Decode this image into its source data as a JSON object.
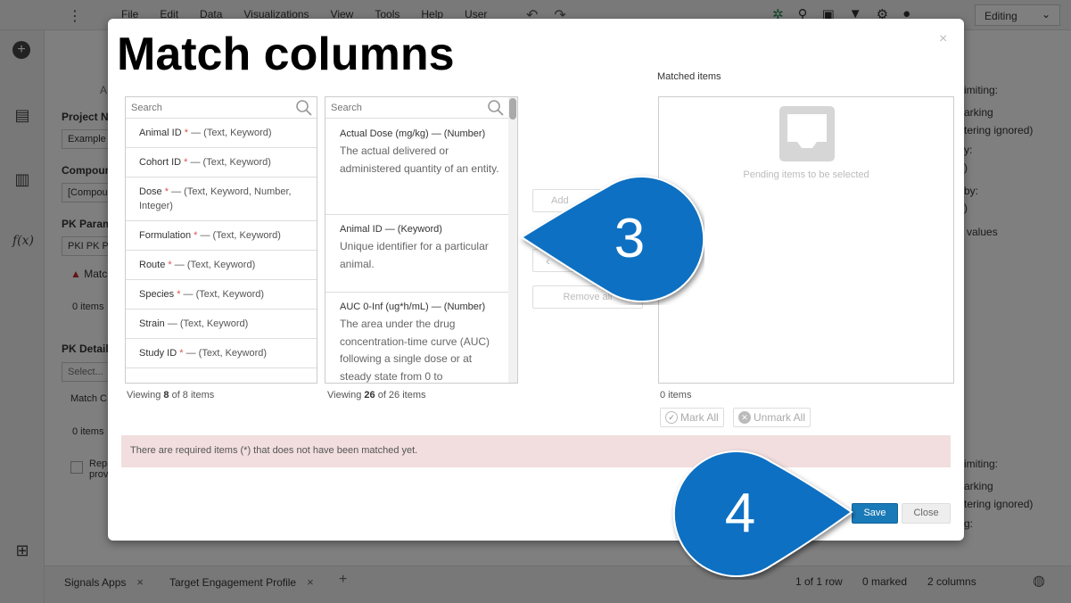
{
  "app": {
    "menu": [
      "File",
      "Edit",
      "Data",
      "Visualizations",
      "View",
      "Tools",
      "Help",
      "User"
    ],
    "mode_select": "Editing",
    "background": {
      "project_label": "Project N",
      "project_value": "Example",
      "compound_label": "Compoun",
      "compound_value": "[Compou",
      "pk_param_label": "PK Param",
      "pk_param_value": "PKI PK P",
      "match_warning": "Match",
      "zero_items_1": "0 items",
      "pk_detail_label": "PK Detail",
      "select_placeholder": "Select...",
      "match_c": "Match C",
      "zero_items_2": "0 items",
      "rep": "Rep",
      "prov": "prov",
      "right_limiting_1": "imiting:",
      "right_marking_1": "arking",
      "right_filtering_1": "tering ignored)",
      "right_y": "y:",
      "right_paren_1": ")",
      "right_by": "by:",
      "right_paren_2": ")",
      "right_values": "values",
      "right_limiting_2": "imiting:",
      "right_marking_2": "arking",
      "right_filtering_2": "tering ignored)",
      "right_g": "g:",
      "left_a": "A"
    },
    "tabs": [
      {
        "label": "Signals Apps"
      },
      {
        "label": "Target Engagement Profile"
      }
    ],
    "status": {
      "rows": "1 of 1 row",
      "marked": "0 marked",
      "columns": "2 columns"
    }
  },
  "modal": {
    "title": "Match columns",
    "left_list": {
      "search_placeholder": "Search",
      "items": [
        {
          "name": "Animal ID",
          "required": "*",
          "types": "— (Text, Keyword)"
        },
        {
          "name": "Cohort ID",
          "required": "*",
          "types": "— (Text, Keyword)"
        },
        {
          "name": "Dose",
          "required": "*",
          "types": "— (Text, Keyword, Number, Integer)"
        },
        {
          "name": "Formulation",
          "required": "*",
          "types": "— (Text, Keyword)"
        },
        {
          "name": "Route",
          "required": "*",
          "types": "— (Text, Keyword)"
        },
        {
          "name": "Species",
          "required": "*",
          "types": "— (Text, Keyword)"
        },
        {
          "name": "Strain",
          "required": "",
          "types": "— (Text, Keyword)"
        },
        {
          "name": "Study ID",
          "required": "*",
          "types": "— (Text, Keyword)"
        }
      ],
      "viewing_prefix": "Viewing",
      "viewing_count": "8",
      "viewing_total": "of 8 items"
    },
    "middle_list": {
      "search_placeholder": "Search",
      "items": [
        {
          "name": "Actual Dose (mg/kg)",
          "type": "— (Number)",
          "desc": "The actual delivered or administered quantity of an entity."
        },
        {
          "name": "Animal ID",
          "type": "— (Keyword)",
          "desc": "Unique identifier for a particular animal."
        },
        {
          "name": "AUC 0-Inf (ug*h/mL)",
          "type": "— (Number)",
          "desc": "The area under the drug concentration-time curve (AUC) following a single dose or at steady state from 0 to"
        }
      ],
      "viewing_prefix": "Viewing",
      "viewing_count": "26",
      "viewing_total": "of 26 items"
    },
    "buttons": {
      "add": "Add",
      "back": "‹",
      "remove_all": "Remove all"
    },
    "matched": {
      "label": "Matched items",
      "pending": "Pending items to be selected",
      "count": "0 items",
      "mark_all": "Mark All",
      "unmark_all": "Unmark All"
    },
    "alert": "There are required items (*) that does not have been matched yet.",
    "save": "Save",
    "close": "Close",
    "close_x": "×"
  },
  "callouts": [
    {
      "number": "3"
    },
    {
      "number": "4"
    }
  ],
  "colors": {
    "callout": "#0a6fc2",
    "save": "#1a7ab8",
    "alert_bg": "#f2dede"
  }
}
